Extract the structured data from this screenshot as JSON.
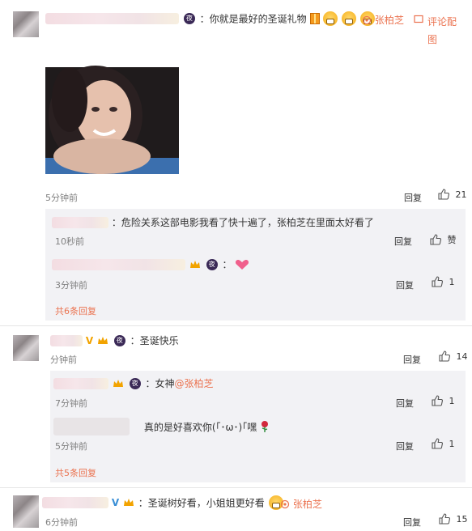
{
  "comments": [
    {
      "text": "：你就是最好的圣诞礼物",
      "repost_label": "张柏芝",
      "comment_with_image_label": "评论配图",
      "time": "5分钟前",
      "reply_label": "回复",
      "likes": "21",
      "replies": [
        {
          "text": "：危险关系这部电影我看了快十遍了，张柏芝在里面太好看了",
          "time": "10秒前",
          "reply_label": "回复",
          "likes": "赞"
        },
        {
          "text": "：",
          "time": "3分钟前",
          "reply_label": "回复",
          "likes": "1"
        }
      ],
      "more_replies": "共6条回复"
    },
    {
      "text": "：圣诞快乐",
      "time": "分钟前",
      "reply_label": "回复",
      "likes": "14",
      "replies": [
        {
          "text": "：女神",
          "mention": "@张柏芝",
          "time": "7分钟前",
          "reply_label": "回复",
          "likes": "1"
        },
        {
          "text": "真的是好喜欢你(｢･ω･)｢嘿",
          "time": "5分钟前",
          "reply_label": "回复",
          "likes": "1"
        }
      ],
      "more_replies": "共5条回复"
    },
    {
      "text": "：圣诞树好看，小姐姐更好看",
      "repost_label": "张柏芝",
      "time": "6分钟前",
      "reply_label": "回复",
      "likes": "15"
    }
  ],
  "badge_char": "夜",
  "vip_char": "V",
  "colors": {
    "accent": "#eb7350",
    "sub_bg": "#f2f2f5",
    "divider": "#e6e6e6"
  },
  "icons": [
    "like-icon",
    "repost-icon",
    "comment-icon",
    "emoji-grin-icon",
    "gift-icon",
    "heart-icon",
    "rose-icon",
    "crown-icon",
    "badge-icon"
  ]
}
